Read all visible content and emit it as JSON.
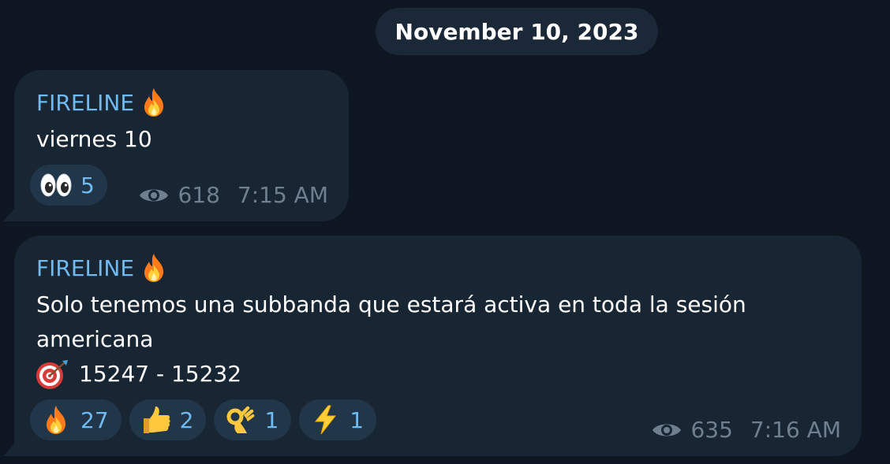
{
  "date_pill": "November 10, 2023",
  "messages": [
    {
      "sender": "FIRELINE",
      "sender_icon": "fire-emoji",
      "lines": [
        "viernes 10"
      ],
      "reactions": [
        {
          "icon": "eyes-emoji",
          "count": "5"
        }
      ],
      "views": "618",
      "time": "7:15 AM"
    },
    {
      "sender": "FIRELINE",
      "sender_icon": "fire-emoji",
      "lines": [
        "Solo tenemos una subbanda que estará activa en toda la sesión",
        "americana"
      ],
      "target_line": {
        "icon": "direct-hit-emoji",
        "text": "15247 - 15232"
      },
      "reactions": [
        {
          "icon": "fire-emoji",
          "count": "27"
        },
        {
          "icon": "thumbs-up-emoji",
          "count": "2"
        },
        {
          "icon": "ok-hand-emoji",
          "count": "1"
        },
        {
          "icon": "lightning-emoji",
          "count": "1"
        }
      ],
      "views": "635",
      "time": "7:16 AM"
    }
  ],
  "colors": {
    "background": "#0e1621",
    "bubble": "#182533",
    "reaction_pill": "#22364a",
    "sender_name": "#71baf0",
    "meta_text": "#6f7f8f",
    "date_pill": "#1b2838"
  }
}
